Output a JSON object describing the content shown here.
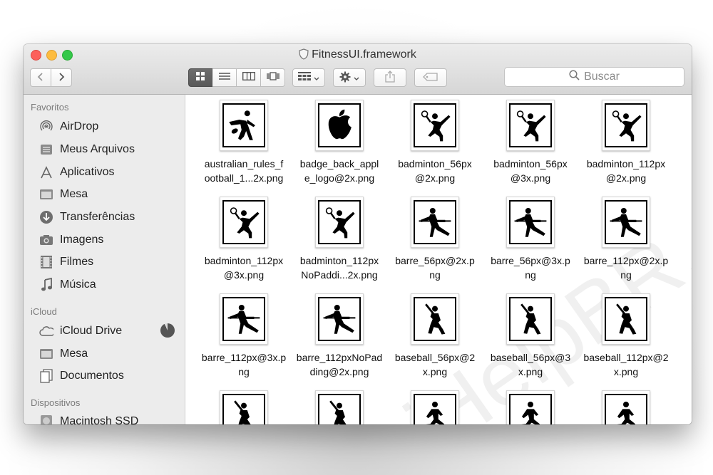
{
  "window": {
    "title": "FitnessUI.framework"
  },
  "toolbar": {
    "search_placeholder": "Buscar"
  },
  "sidebar": {
    "sections": [
      {
        "heading": "Favoritos",
        "items": [
          {
            "label": "AirDrop",
            "icon": "airdrop-icon"
          },
          {
            "label": "Meus Arquivos",
            "icon": "all-files-icon"
          },
          {
            "label": "Aplicativos",
            "icon": "applications-icon"
          },
          {
            "label": "Mesa",
            "icon": "desktop-icon"
          },
          {
            "label": "Transferências",
            "icon": "downloads-icon"
          },
          {
            "label": "Imagens",
            "icon": "camera-icon"
          },
          {
            "label": "Filmes",
            "icon": "film-icon"
          },
          {
            "label": "Música",
            "icon": "music-note-icon"
          }
        ]
      },
      {
        "heading": "iCloud",
        "items": [
          {
            "label": "iCloud Drive",
            "icon": "cloud-icon"
          },
          {
            "label": "Mesa",
            "icon": "desktop-icon"
          },
          {
            "label": "Documentos",
            "icon": "documents-icon"
          }
        ]
      },
      {
        "heading": "Dispositivos",
        "items": [
          {
            "label": "Macintosh SSD",
            "icon": "disk-icon"
          }
        ]
      }
    ]
  },
  "files": [
    {
      "line1": "australian_rules_f",
      "line2": "ootball_1...2x.png",
      "icon": "australian-rules-football-icon"
    },
    {
      "line1": "badge_back_appl",
      "line2": "e_logo@2x.png",
      "icon": "apple-logo-icon"
    },
    {
      "line1": "badminton_56px",
      "line2": "@2x.png",
      "icon": "badminton-icon"
    },
    {
      "line1": "badminton_56px",
      "line2": "@3x.png",
      "icon": "badminton-icon"
    },
    {
      "line1": "badminton_112px",
      "line2": "@2x.png",
      "icon": "badminton-icon"
    },
    {
      "line1": "badminton_112px",
      "line2": "@3x.png",
      "icon": "badminton-icon"
    },
    {
      "line1": "badminton_112px",
      "line2": "NoPaddi...2x.png",
      "icon": "badminton-icon"
    },
    {
      "line1": "barre_56px@2x.p",
      "line2": "ng",
      "icon": "barre-icon"
    },
    {
      "line1": "barre_56px@3x.p",
      "line2": "ng",
      "icon": "barre-icon"
    },
    {
      "line1": "barre_112px@2x.p",
      "line2": "ng",
      "icon": "barre-icon"
    },
    {
      "line1": "barre_112px@3x.p",
      "line2": "ng",
      "icon": "barre-icon"
    },
    {
      "line1": "barre_112pxNoPad",
      "line2": "ding@2x.png",
      "icon": "barre-icon"
    },
    {
      "line1": "baseball_56px@2",
      "line2": "x.png",
      "icon": "baseball-icon"
    },
    {
      "line1": "baseball_56px@3",
      "line2": "x.png",
      "icon": "baseball-icon"
    },
    {
      "line1": "baseball_112px@2",
      "line2": "x.png",
      "icon": "baseball-icon"
    },
    {
      "line1": "",
      "line2": "",
      "icon": "baseball-icon"
    },
    {
      "line1": "",
      "line2": "",
      "icon": "baseball-icon"
    },
    {
      "line1": "",
      "line2": "",
      "icon": "basketball-icon"
    },
    {
      "line1": "",
      "line2": "",
      "icon": "basketball-icon"
    },
    {
      "line1": "",
      "line2": "",
      "icon": "basketball-icon"
    }
  ]
}
